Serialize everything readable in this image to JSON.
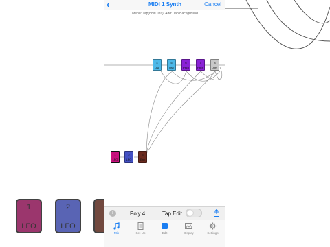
{
  "navbar": {
    "title": "MIDI 1 Synth",
    "cancel_label": "Cancel"
  },
  "hint": "Menu: Tap(hold unit), Add: Tap Background",
  "nodes": [
    {
      "num": "4",
      "label": "Osc",
      "color": "#4db8e8"
    },
    {
      "num": "5",
      "label": "Osc",
      "color": "#4db8e8"
    },
    {
      "num": "6",
      "label": "Pitch",
      "color": "#8a22d6"
    },
    {
      "num": "7",
      "label": "Pitch",
      "color": "#8a22d6"
    },
    {
      "num": "8",
      "label": "Am",
      "color": "#c8c8c8"
    },
    {
      "num": "1",
      "label": "LFO",
      "color": "#c8127e"
    },
    {
      "num": "2",
      "label": "LFO",
      "color": "#4451c4"
    },
    {
      "num": "3",
      "label": "Env",
      "color": "#6a2a1e"
    }
  ],
  "toolbar": {
    "poly_label": "Poly 4",
    "tapedit_label": "Tap Edit",
    "tapedit_on": false
  },
  "tabs": [
    {
      "label": "Mix",
      "icon": "music-note-icon",
      "active": true
    },
    {
      "label": "Set-Up",
      "icon": "document-icon",
      "active": false
    },
    {
      "label": "Edit",
      "icon": "square-icon",
      "active": false
    },
    {
      "label": "Display",
      "icon": "image-icon",
      "active": false
    },
    {
      "label": "Settings",
      "icon": "gear-icon",
      "active": false
    }
  ],
  "background": {
    "blocks": [
      {
        "num": "1",
        "label": "LFO",
        "color": "#8a1454"
      },
      {
        "num": "2",
        "label": "LFO",
        "color": "#3d4aa8"
      },
      {
        "num": "",
        "label": "",
        "color": "#5a2a1e"
      }
    ]
  },
  "colors": {
    "accent": "#1a7ef2",
    "wire": "#8a8a8a"
  }
}
